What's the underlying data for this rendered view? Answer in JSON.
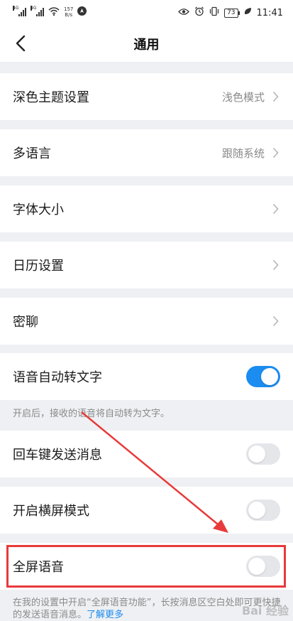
{
  "status_bar": {
    "signal1": "4G",
    "signal2": "4G",
    "speed_value": "157",
    "speed_unit": "B/s",
    "battery": "73",
    "time": "11:41"
  },
  "navbar": {
    "title": "通用"
  },
  "settings": {
    "dark_theme": {
      "label": "深色主题设置",
      "value": "浅色模式"
    },
    "language": {
      "label": "多语言",
      "value": "跟随系统"
    },
    "font_size": {
      "label": "字体大小"
    },
    "calendar": {
      "label": "日历设置"
    },
    "secret_chat": {
      "label": "密聊"
    },
    "voice_to_text": {
      "label": "语音自动转文字",
      "on": true,
      "note": "开启后，接收的语音将自动转为文字。"
    },
    "enter_send": {
      "label": "回车键发送消息",
      "on": false
    },
    "landscape": {
      "label": "开启横屏模式",
      "on": false
    },
    "fullscreen_voice": {
      "label": "全屏语音",
      "on": false,
      "note": "在我的设置中开启“全屏语音功能”，长按消息区空白处即可更快捷的发送语音消息。",
      "link": "了解更多"
    }
  },
  "watermark": "Bai 经验",
  "colors": {
    "accent": "#1b8cf0",
    "annotation": "#e83a3a",
    "background": "#eef0f3"
  }
}
